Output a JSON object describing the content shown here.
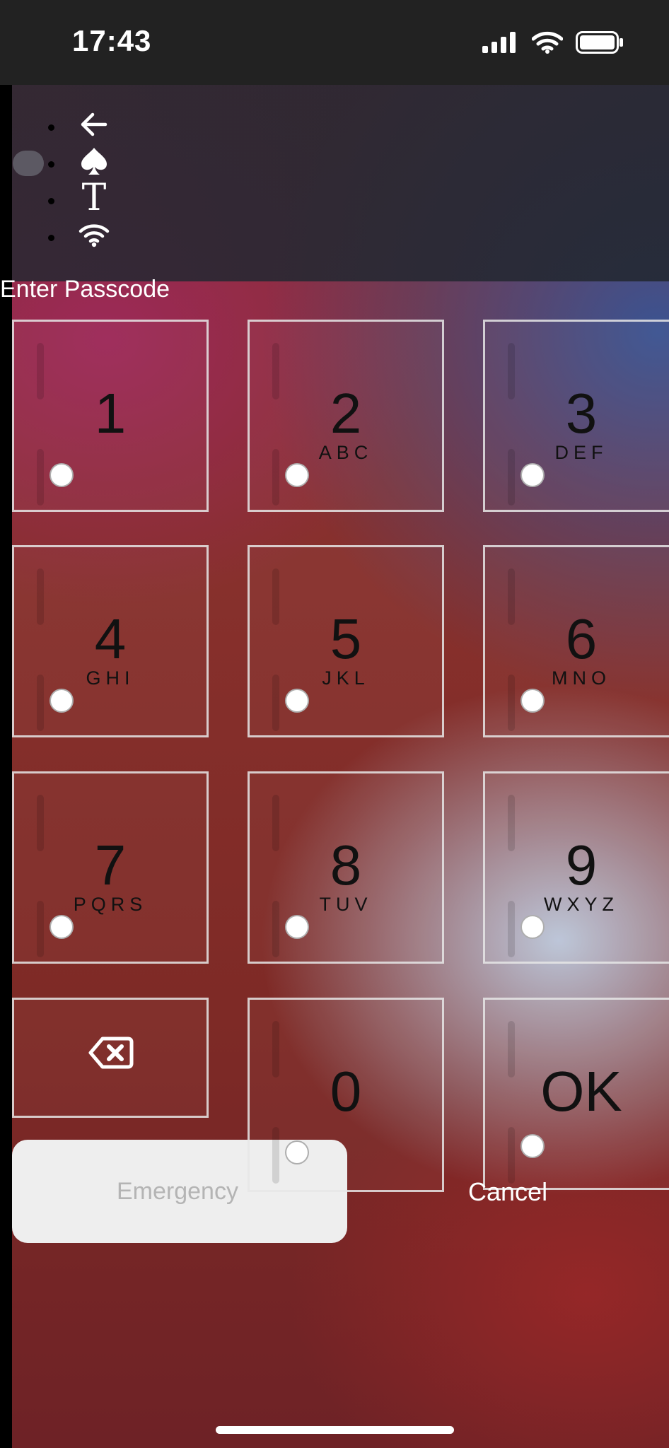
{
  "status_bar": {
    "time": "17:43",
    "icons": [
      "signal-icon",
      "wifi-icon",
      "battery-icon"
    ]
  },
  "menu": {
    "items": [
      {
        "icon": "arrow-left-icon"
      },
      {
        "icon": "spade-icon"
      },
      {
        "icon": "text-t-icon",
        "glyph": "T"
      },
      {
        "icon": "wifi-icon"
      }
    ]
  },
  "title": "Enter Passcode",
  "keypad": {
    "keys": [
      {
        "digit": "1",
        "letters": ""
      },
      {
        "digit": "2",
        "letters": "ABC"
      },
      {
        "digit": "3",
        "letters": "DEF"
      },
      {
        "digit": "4",
        "letters": "GHI"
      },
      {
        "digit": "5",
        "letters": "JKL"
      },
      {
        "digit": "6",
        "letters": "MNO"
      },
      {
        "digit": "7",
        "letters": "PQRS"
      },
      {
        "digit": "8",
        "letters": "TUV"
      },
      {
        "digit": "9",
        "letters": "WXYZ"
      },
      {
        "icon": "backspace-icon"
      },
      {
        "digit": "0",
        "letters": ""
      },
      {
        "label": "OK"
      }
    ]
  },
  "buttons": {
    "emergency": "Emergency",
    "cancel": "Cancel"
  },
  "colors": {
    "statusbar": "#222222",
    "topbar": "#2b2c36",
    "key_border": "#e6e6e6",
    "emergency_bg": "#eeeeee",
    "emergency_text": "#b4b4b4"
  }
}
